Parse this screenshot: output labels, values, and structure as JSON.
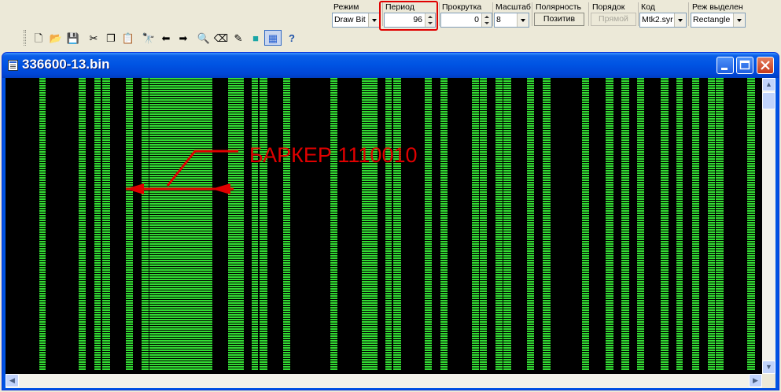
{
  "controls": {
    "mode": {
      "label": "Режим",
      "value": "Draw Bit"
    },
    "period": {
      "label": "Период",
      "value": "96"
    },
    "scroll": {
      "label": "Прокрутка",
      "value": "0"
    },
    "scale": {
      "label": "Масштаб",
      "value": "8"
    },
    "polarity": {
      "label": "Полярность",
      "button": "Позитив"
    },
    "order": {
      "label": "Порядок",
      "button": "Прямой"
    },
    "code": {
      "label": "Код",
      "value": "Mtk2.syr"
    },
    "select_mode": {
      "label": "Реж выделен",
      "value": "Rectangle"
    }
  },
  "toolbar": {
    "items": [
      {
        "name": "new-file-icon",
        "glyph": "🗋",
        "active": false
      },
      {
        "name": "open-folder-icon",
        "glyph": "📂",
        "active": false
      },
      {
        "name": "save-icon",
        "glyph": "💾",
        "active": false
      },
      {
        "name": "cut-icon",
        "glyph": "✂",
        "active": false
      },
      {
        "name": "copy-icon",
        "glyph": "❐",
        "active": false
      },
      {
        "name": "paste-icon",
        "glyph": "📋",
        "active": false
      },
      {
        "name": "find-icon",
        "glyph": "🔭",
        "active": false
      },
      {
        "name": "arrow-left-icon",
        "glyph": "⬅",
        "active": false
      },
      {
        "name": "arrow-right-icon",
        "glyph": "➡",
        "active": false
      },
      {
        "name": "zoom-icon",
        "glyph": "🔍",
        "active": false
      },
      {
        "name": "eraser-icon",
        "glyph": "⌫",
        "active": false
      },
      {
        "name": "pencil-icon",
        "glyph": "✎",
        "active": false
      },
      {
        "name": "rectangle-icon",
        "glyph": "■",
        "active": false
      },
      {
        "name": "grid-icon",
        "glyph": "▦",
        "active": true
      },
      {
        "name": "help-icon",
        "glyph": "?",
        "active": false
      }
    ]
  },
  "window": {
    "title": "336600-13.bin"
  },
  "annotation": {
    "text": "БАРКЕР  1110010",
    "color": "#e00000"
  },
  "colors": {
    "bit_green": "#33dd33",
    "background": "#000000",
    "highlight_red": "#e00000"
  }
}
